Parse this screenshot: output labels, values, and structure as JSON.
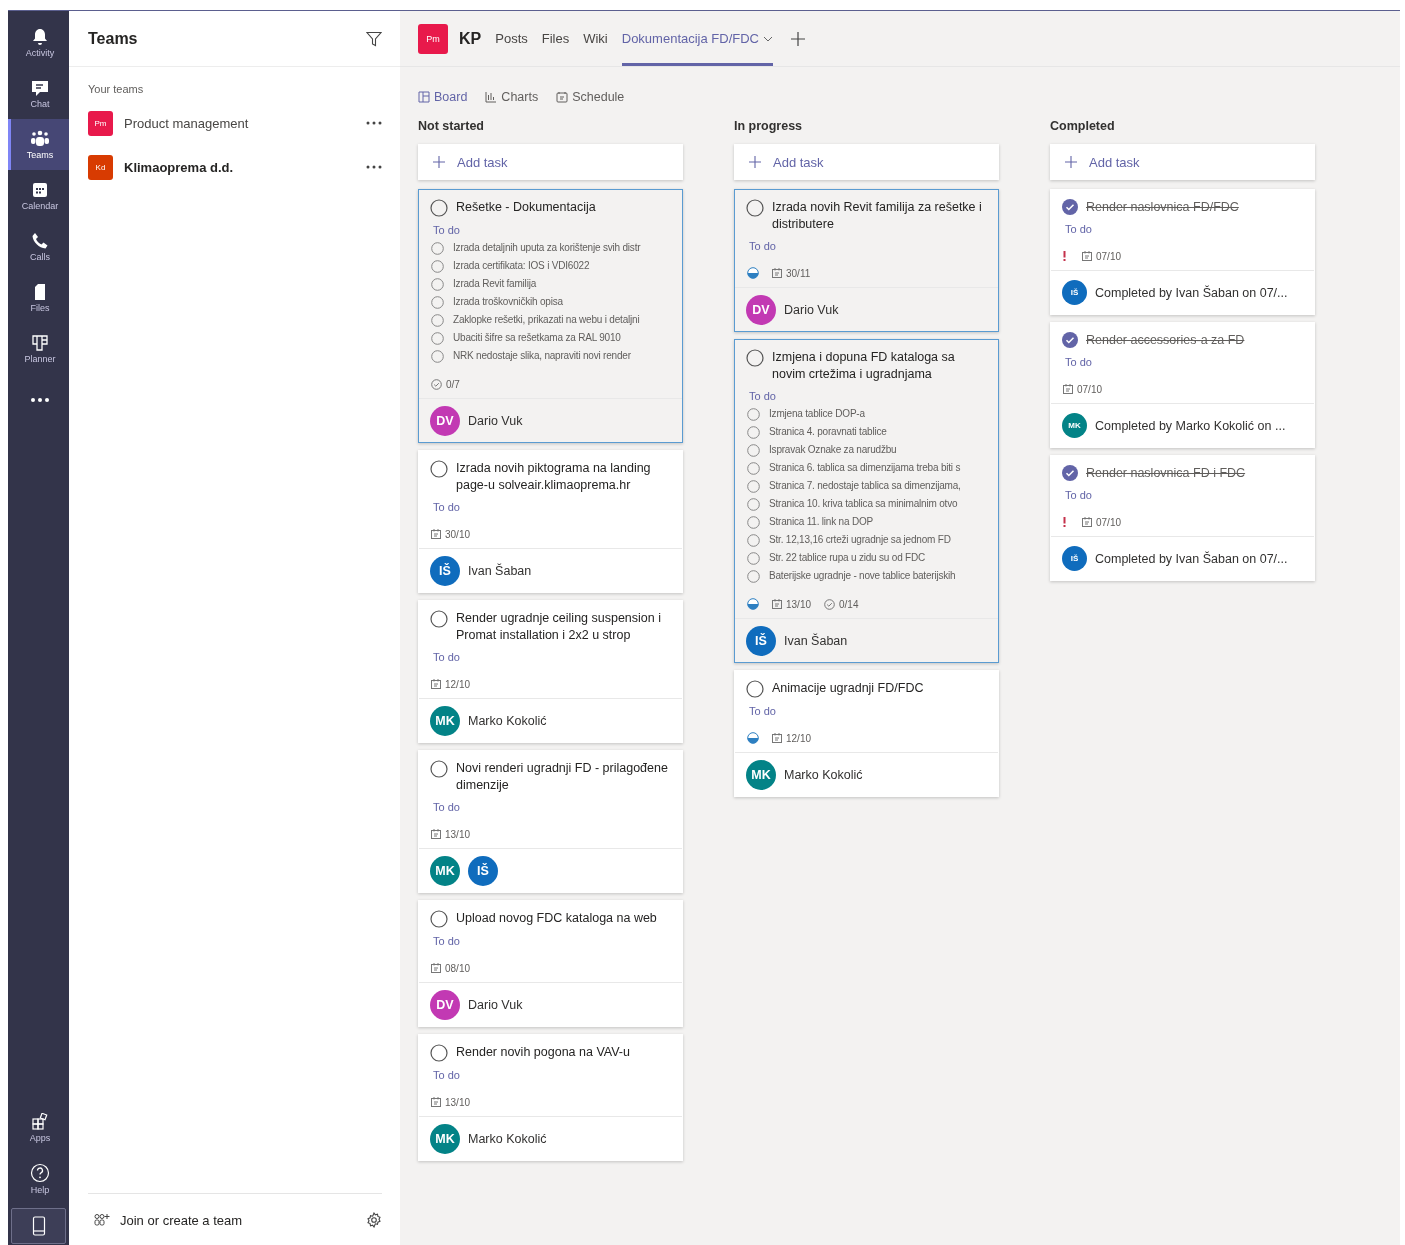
{
  "rail": {
    "items": [
      {
        "kind": "bell",
        "label": "Activity",
        "selected": false
      },
      {
        "kind": "chat",
        "label": "Chat",
        "selected": false
      },
      {
        "kind": "teams",
        "label": "Teams",
        "selected": true
      },
      {
        "kind": "calendar",
        "label": "Calendar",
        "selected": false
      },
      {
        "kind": "phone",
        "label": "Calls",
        "selected": false
      },
      {
        "kind": "file",
        "label": "Files",
        "selected": false
      },
      {
        "kind": "planner",
        "label": "Planner",
        "selected": false
      },
      {
        "kind": "more",
        "selected": false
      }
    ],
    "bottom": [
      {
        "kind": "apps",
        "label": "Apps"
      },
      {
        "kind": "help",
        "label": "Help"
      },
      {
        "kind": "device"
      }
    ]
  },
  "teams_panel": {
    "title": "Teams",
    "section": "Your teams",
    "teams": [
      {
        "initials": "Pm",
        "name": "Product management",
        "color": "#e8194b",
        "unread": false
      },
      {
        "initials": "Kd",
        "name": "Klimaoprema d.d.",
        "color": "#d83b01",
        "unread": true
      }
    ],
    "footer": "Join or create a team"
  },
  "header": {
    "team_initials": "Pm",
    "channel": "KP",
    "tabs": [
      {
        "label": "Posts",
        "selected": false,
        "dropdown": false
      },
      {
        "label": "Files",
        "selected": false,
        "dropdown": false
      },
      {
        "label": "Wiki",
        "selected": false,
        "dropdown": false
      },
      {
        "label": "Dokumentacija FD/FDC",
        "selected": true,
        "dropdown": true
      }
    ]
  },
  "views": [
    {
      "kind": "board",
      "label": "Board",
      "selected": true
    },
    {
      "kind": "charts",
      "label": "Charts",
      "selected": false
    },
    {
      "kind": "schedule",
      "label": "Schedule",
      "selected": false
    }
  ],
  "columns": [
    {
      "title": "Not started",
      "add_label": "Add task",
      "cards": [
        {
          "title": "Rešetke - Dokumentacija",
          "completed": false,
          "highlighted": true,
          "bucket": "To do",
          "checklist": [
            "Izrada detaljnih uputa za korištenje svih distr",
            "Izrada certifikata: IOS i VDI6022",
            "Izrada Revit familija",
            "Izrada troškovničkih opisa",
            "Zaklopke rešetki, prikazati na webu i detaljni",
            "Ubaciti šifre sa rešetkama za RAL 9010",
            "NRK nedostaje slika, napraviti novi render"
          ],
          "in_progress": false,
          "urgent": false,
          "checklist_count": "0/7",
          "assignees": [
            {
              "initials": "DV",
              "color": "#c239b3"
            }
          ],
          "footer_text": "Dario Vuk"
        },
        {
          "title": "Izrada novih piktograma na landing page-u solveair.klimaoprema.hr",
          "completed": false,
          "highlighted": false,
          "bucket": "To do",
          "in_progress": false,
          "urgent": false,
          "due": "30/10",
          "assignees": [
            {
              "initials": "IŠ",
              "color": "#0f6cbd"
            }
          ],
          "footer_text": "Ivan Šaban"
        },
        {
          "title": "Render ugradnje ceiling suspension i Promat installation i 2x2 u strop",
          "completed": false,
          "highlighted": false,
          "bucket": "To do",
          "in_progress": false,
          "urgent": false,
          "due": "12/10",
          "assignees": [
            {
              "initials": "MK",
              "color": "#038387"
            }
          ],
          "footer_text": "Marko Kokolić"
        },
        {
          "title": "Novi renderi ugradnji FD - prilagođene dimenzije",
          "completed": false,
          "highlighted": false,
          "bucket": "To do",
          "in_progress": false,
          "urgent": false,
          "due": "13/10",
          "assignees": [
            {
              "initials": "MK",
              "color": "#038387"
            },
            {
              "initials": "IŠ",
              "color": "#0f6cbd"
            }
          ]
        },
        {
          "title": "Upload novog FDC kataloga na web",
          "completed": false,
          "highlighted": false,
          "bucket": "To do",
          "in_progress": false,
          "urgent": false,
          "due": "08/10",
          "assignees": [
            {
              "initials": "DV",
              "color": "#c239b3"
            }
          ],
          "footer_text": "Dario Vuk"
        },
        {
          "title": "Render novih pogona na VAV-u",
          "completed": false,
          "highlighted": false,
          "bucket": "To do",
          "in_progress": false,
          "urgent": false,
          "due": "13/10",
          "assignees": [
            {
              "initials": "MK",
              "color": "#038387"
            }
          ],
          "footer_text": "Marko Kokolić"
        }
      ]
    },
    {
      "title": "In progress",
      "add_label": "Add task",
      "cards": [
        {
          "title": "Izrada novih Revit familija za rešetke i distributere",
          "completed": false,
          "highlighted": true,
          "bucket": "To do",
          "in_progress": true,
          "urgent": false,
          "due": "30/11",
          "assignees": [
            {
              "initials": "DV",
              "color": "#c239b3"
            }
          ],
          "footer_text": "Dario Vuk"
        },
        {
          "title": "Izmjena i dopuna FD kataloga sa novim crtežima i ugradnjama",
          "completed": false,
          "highlighted": true,
          "bucket": "To do",
          "checklist": [
            "Izmjena tablice DOP-a",
            "Stranica 4. poravnati tablice",
            "Ispravak Oznake za narudžbu",
            "Stranica 6. tablica sa dimenzijama treba biti s",
            "Stranica 7. nedostaje tablica sa dimenzijama,",
            "Stranica 10. kriva tablica sa minimalnim otvo",
            "Stranica 11. link na DOP",
            "Str. 12,13,16 crteži ugradnje sa jednom FD",
            "Str. 22 tablice rupa u zidu su od FDC",
            "Baterijske ugradnje - nove tablice baterijskih"
          ],
          "in_progress": true,
          "urgent": false,
          "due": "13/10",
          "checklist_count": "0/14",
          "assignees": [
            {
              "initials": "IŠ",
              "color": "#0f6cbd"
            }
          ],
          "footer_text": "Ivan Šaban"
        },
        {
          "title": "Animacije ugradnji FD/FDC",
          "completed": false,
          "highlighted": false,
          "bucket": "To do",
          "in_progress": true,
          "urgent": false,
          "due": "12/10",
          "assignees": [
            {
              "initials": "MK",
              "color": "#038387"
            }
          ],
          "footer_text": "Marko Kokolić"
        }
      ]
    },
    {
      "title": "Completed",
      "add_label": "Add task",
      "cards": [
        {
          "title": "Render naslovnica FD/FDC",
          "completed": true,
          "highlighted": false,
          "bucket": "To do",
          "in_progress": false,
          "urgent": true,
          "due": "07/10",
          "assignees": [
            {
              "initials": "IŠ",
              "color": "#0f6cbd"
            }
          ],
          "footer_text": "Completed by Ivan Šaban on 07/..."
        },
        {
          "title": "Render accessories-a za FD",
          "completed": true,
          "highlighted": false,
          "bucket": "To do",
          "in_progress": false,
          "urgent": false,
          "due": "07/10",
          "assignees": [
            {
              "initials": "MK",
              "color": "#038387"
            }
          ],
          "footer_text": "Completed by Marko Kokolić on ..."
        },
        {
          "title": "Render naslovnica FD i FDC",
          "completed": true,
          "highlighted": false,
          "bucket": "To do",
          "in_progress": false,
          "urgent": true,
          "due": "07/10",
          "assignees": [
            {
              "initials": "IŠ",
              "color": "#0f6cbd"
            }
          ],
          "footer_text": "Completed by Ivan Šaban on 07/..."
        }
      ]
    }
  ]
}
